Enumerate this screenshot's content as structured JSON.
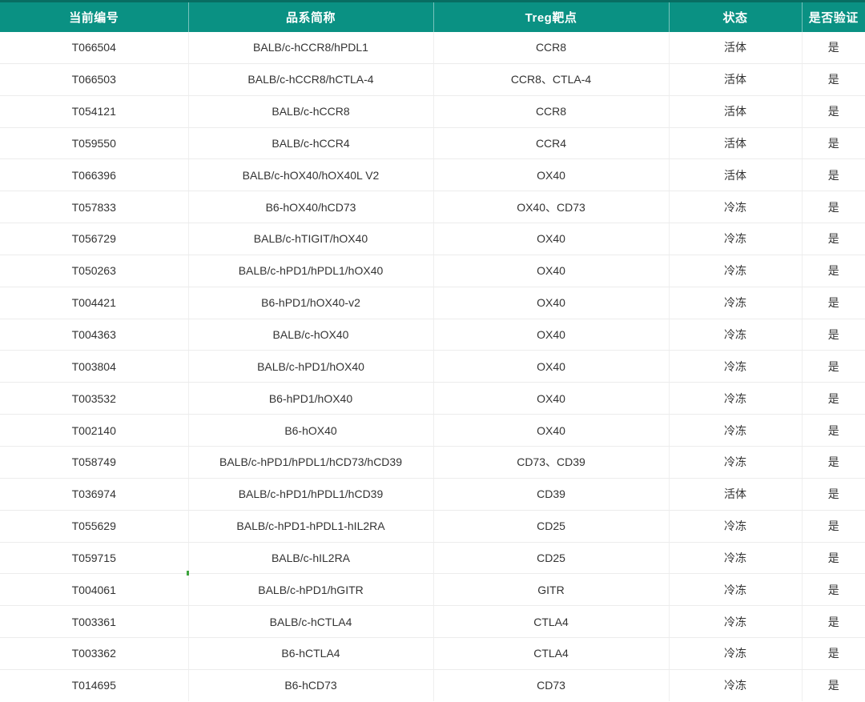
{
  "chart_data": {
    "type": "table",
    "columns": [
      "当前编号",
      "品系简称",
      "Treg靶点",
      "状态",
      "是否验证"
    ],
    "rows": [
      [
        "T066504",
        "BALB/c-hCCR8/hPDL1",
        "CCR8",
        "活体",
        "是"
      ],
      [
        "T066503",
        "BALB/c-hCCR8/hCTLA-4",
        "CCR8、CTLA-4",
        "活体",
        "是"
      ],
      [
        "T054121",
        "BALB/c-hCCR8",
        "CCR8",
        "活体",
        "是"
      ],
      [
        "T059550",
        "BALB/c-hCCR4",
        "CCR4",
        "活体",
        "是"
      ],
      [
        "T066396",
        "BALB/c-hOX40/hOX40L V2",
        "OX40",
        "活体",
        "是"
      ],
      [
        "T057833",
        "B6-hOX40/hCD73",
        "OX40、CD73",
        "冷冻",
        "是"
      ],
      [
        "T056729",
        "BALB/c-hTIGIT/hOX40",
        "OX40",
        "冷冻",
        "是"
      ],
      [
        "T050263",
        "BALB/c-hPD1/hPDL1/hOX40",
        "OX40",
        "冷冻",
        "是"
      ],
      [
        "T004421",
        "B6-hPD1/hOX40-v2",
        "OX40",
        "冷冻",
        "是"
      ],
      [
        "T004363",
        "BALB/c-hOX40",
        "OX40",
        "冷冻",
        "是"
      ],
      [
        "T003804",
        "BALB/c-hPD1/hOX40",
        "OX40",
        "冷冻",
        "是"
      ],
      [
        "T003532",
        "B6-hPD1/hOX40",
        "OX40",
        "冷冻",
        "是"
      ],
      [
        "T002140",
        "B6-hOX40",
        "OX40",
        "冷冻",
        "是"
      ],
      [
        "T058749",
        "BALB/c-hPD1/hPDL1/hCD73/hCD39",
        "CD73、CD39",
        "冷冻",
        "是"
      ],
      [
        "T036974",
        "BALB/c-hPD1/hPDL1/hCD39",
        "CD39",
        "活体",
        "是"
      ],
      [
        "T055629",
        "BALB/c-hPD1-hPDL1-hIL2RA",
        "CD25",
        "冷冻",
        "是"
      ],
      [
        "T059715",
        "BALB/c-hIL2RA",
        "CD25",
        "冷冻",
        "是"
      ],
      [
        "T004061",
        "BALB/c-hPD1/hGITR",
        "GITR",
        "冷冻",
        "是"
      ],
      [
        "T003361",
        "BALB/c-hCTLA4",
        "CTLA4",
        "冷冻",
        "是"
      ],
      [
        "T003362",
        "B6-hCTLA4",
        "CTLA4",
        "冷冻",
        "是"
      ],
      [
        "T014695",
        "B6-hCD73",
        "CD73",
        "冷冻",
        "是"
      ]
    ]
  },
  "colors": {
    "header_background": "#0a9183",
    "header_top_border": "#086d62",
    "header_text": "#ffffff",
    "header_separator": "rgba(255,255,255,0.45)",
    "body_text": "#333333",
    "grid_line": "#ececec",
    "row_background": "#ffffff",
    "stray_mark_green": "#3da43d"
  }
}
